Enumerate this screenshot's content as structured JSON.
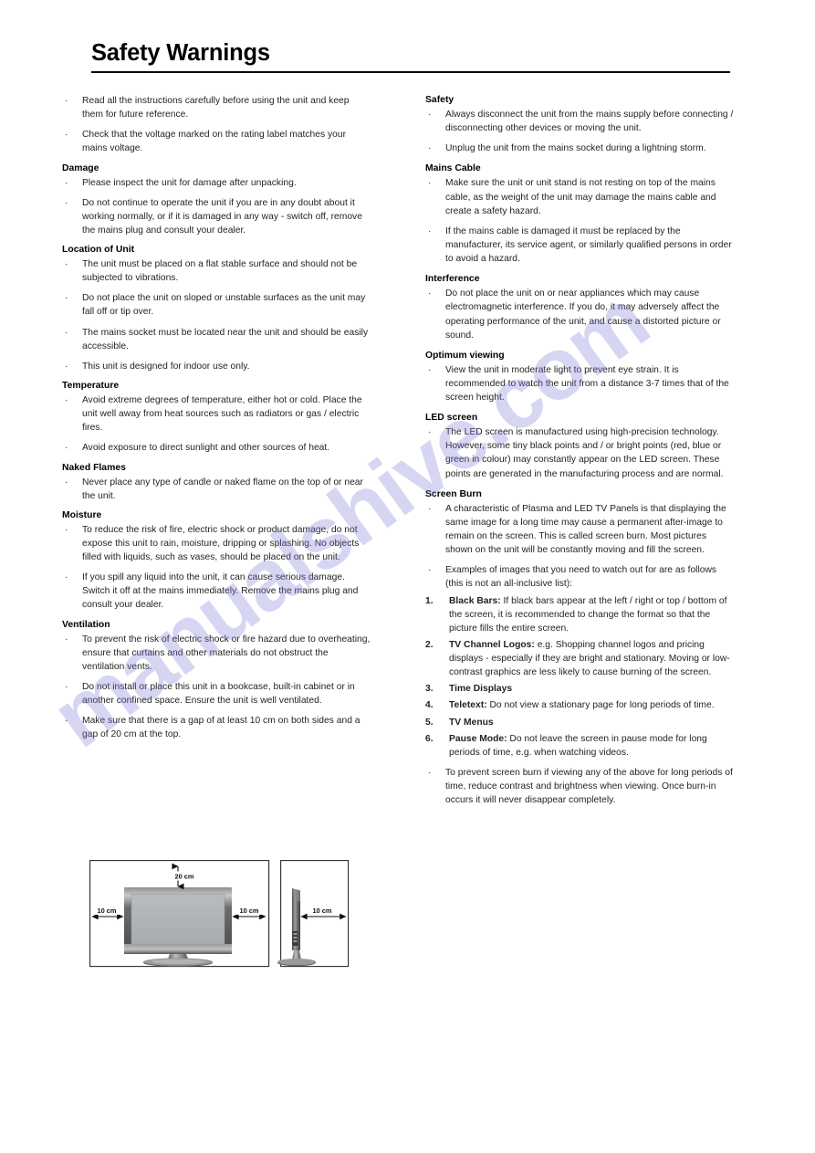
{
  "page": {
    "title": "Safety Warnings",
    "watermark": "manualshive.com"
  },
  "left_column": {
    "intro_bullets": [
      "Read all the instructions carefully before using the unit and keep them for future reference.",
      "Check that the voltage marked on the rating label matches your mains voltage."
    ],
    "sections": [
      {
        "heading": "Damage",
        "bullets": [
          "Please inspect the unit for damage after unpacking.",
          "Do not continue to operate the unit if you are in any doubt about it working normally, or if it is damaged in any way - switch off, remove the mains plug and consult your dealer."
        ]
      },
      {
        "heading": "Location of Unit",
        "bullets": [
          "The unit must be placed on a flat stable surface and should not be subjected to vibrations.",
          "Do not place the unit on sloped or unstable surfaces as the unit may fall off or tip over.",
          "The mains socket must be located near the unit and should be easily accessible.",
          "This unit is designed for indoor use only."
        ]
      },
      {
        "heading": "Temperature",
        "bullets": [
          "Avoid extreme degrees of temperature, either hot or cold. Place the unit well away from heat sources such as radiators or gas / electric fires.",
          "Avoid exposure to direct sunlight and other sources of heat."
        ]
      },
      {
        "heading": "Naked Flames",
        "bullets": [
          "Never place any type of candle or naked flame on the top of or near the unit."
        ]
      },
      {
        "heading": "Moisture",
        "bullets": [
          "To reduce the risk of fire, electric shock or product damage, do not expose this unit to rain, moisture, dripping or splashing. No objects filled with liquids, such as vases, should be placed on the unit.",
          "If you spill any liquid into the unit, it can cause serious damage. Switch it off at the mains immediately. Remove the mains plug and consult your dealer."
        ]
      },
      {
        "heading": "Ventilation",
        "bullets": [
          "To prevent the risk of electric shock or fire hazard due to overheating, ensure that curtains and other materials do not obstruct the ventilation vents.",
          "Do not install or place this unit in a bookcase, built-in cabinet or in another confined space. Ensure the unit is well ventilated.",
          "Make sure that there is a gap of at least 10 cm on both sides and a gap of 20 cm at the top."
        ]
      }
    ]
  },
  "right_column": {
    "sections": [
      {
        "heading": "Safety",
        "bullets": [
          "Always disconnect the unit from the mains supply before connecting / disconnecting other devices or moving the unit.",
          "Unplug the unit from the mains socket during a lightning storm."
        ]
      },
      {
        "heading": "Mains Cable",
        "bullets": [
          "Make sure the unit or unit stand is not resting on top of the mains cable, as the weight of the unit may damage the mains cable and create a safety hazard.",
          "If the mains cable is damaged it must be replaced by the manufacturer, its service agent, or similarly qualified persons in order to avoid a hazard."
        ]
      },
      {
        "heading": "Interference",
        "bullets": [
          "Do not place the unit on or near appliances which may cause electromagnetic interference. If you do, it may adversely affect the operating performance of the unit, and cause a distorted picture or sound."
        ]
      },
      {
        "heading": "Optimum viewing",
        "bullets": [
          "View the unit in moderate light to prevent eye strain. It is recommended to watch the unit from a distance 3-7 times that of the screen height."
        ]
      },
      {
        "heading": "LED screen",
        "bullets": [
          "The LED screen is manufactured using high-precision technology. However, some tiny black points and / or bright points (red, blue or green in colour) may constantly appear on the LED screen. These points are generated in the manufacturing process and are normal."
        ]
      }
    ],
    "screen_burn": {
      "heading": "Screen Burn",
      "bullet_1": "A characteristic of Plasma and LED TV Panels is that displaying the same image for a long time may cause a permanent after-image to remain on the screen. This is called screen burn. Most pictures shown on the unit will be constantly moving and fill the screen.",
      "bullet_2": "Examples of images that you need to watch out for are as follows (this is not an all-inclusive list):",
      "numbered": [
        {
          "n": "1.",
          "label": "Black Bars:",
          "text": " If black bars appear at the left / right or top / bottom of the screen, it is recommended to change the format so that the picture fills the entire screen."
        },
        {
          "n": "2.",
          "label": "TV Channel Logos:",
          "text": " e.g. Shopping channel logos and pricing displays - especially if they are bright and stationary. Moving or low-contrast graphics are less likely to cause burning of the screen."
        },
        {
          "n": "3.",
          "label": "Time Displays",
          "text": ""
        },
        {
          "n": "4.",
          "label": "Teletext:",
          "text": " Do not view a stationary page for long periods of time."
        },
        {
          "n": "5.",
          "label": "TV Menus",
          "text": ""
        },
        {
          "n": "6.",
          "label": "Pause Mode:",
          "text": " Do not leave the screen in pause mode for long periods of time, e.g. when watching videos."
        }
      ],
      "bullet_3": "To prevent screen burn if viewing any of the above for long periods of time, reduce contrast and brightness when viewing. Once burn-in occurs it will never disappear completely."
    }
  },
  "diagram": {
    "label_top": "20 cm",
    "label_left": "10 cm",
    "label_right": "10 cm",
    "label_side": "10 cm"
  }
}
